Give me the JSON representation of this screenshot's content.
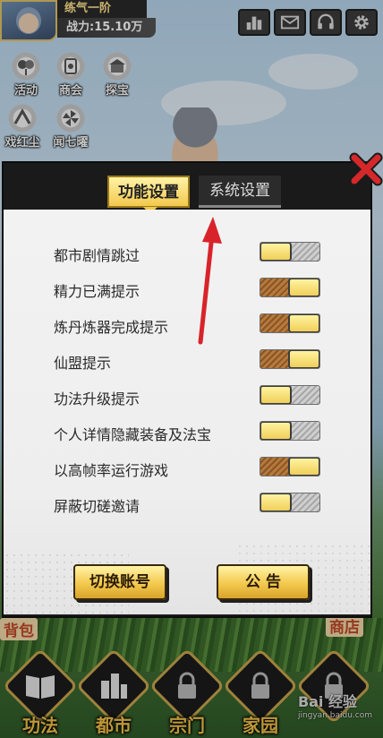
{
  "player": {
    "name": "练气一阶",
    "power": "战力:15.10万"
  },
  "top_icons": [
    "ranking-icon",
    "mail-icon",
    "headset-icon",
    "gear-icon"
  ],
  "quick_actions": [
    {
      "label": "活动",
      "icon": "activity-icon"
    },
    {
      "label": "商会",
      "icon": "shop-icon"
    },
    {
      "label": "探宝",
      "icon": "treasure-icon"
    },
    {
      "label": "戏红尘",
      "icon": "fan-icon"
    },
    {
      "label": "闻七曜",
      "icon": "pinwheel-icon"
    }
  ],
  "dialog": {
    "tabs": {
      "active": "功能设置",
      "inactive": "系统设置"
    },
    "settings": [
      {
        "label": "都市剧情跳过",
        "state": "off"
      },
      {
        "label": "精力已满提示",
        "state": "on"
      },
      {
        "label": "炼丹炼器完成提示",
        "state": "on"
      },
      {
        "label": "仙盟提示",
        "state": "on"
      },
      {
        "label": "功法升级提示",
        "state": "off"
      },
      {
        "label": "个人详情隐藏装备及法宝",
        "state": "off"
      },
      {
        "label": "以高帧率运行游戏",
        "state": "on"
      },
      {
        "label": "屏蔽切磋邀请",
        "state": "off"
      }
    ],
    "buttons": {
      "switch_account": "切换账号",
      "announcement": "公 告"
    }
  },
  "side_tags": {
    "left": "背包",
    "right": "商店"
  },
  "bottom_nav": [
    {
      "label": "功法",
      "icon": "book-icon",
      "locked": false
    },
    {
      "label": "都市",
      "icon": "city-icon",
      "locked": false
    },
    {
      "label": "宗门",
      "icon": "lock-icon",
      "locked": true
    },
    {
      "label": "家园",
      "icon": "lock-icon",
      "locked": true
    },
    {
      "label": "",
      "icon": "lock-icon",
      "locked": true
    }
  ],
  "watermark": {
    "brand": "Bai 经验",
    "url": "jingyan.baidu.com"
  },
  "colors": {
    "gold": "#f3c94d",
    "toggle_on": "#b57a3c",
    "toggle_off": "#bdbdbd",
    "close_red": "#d4282b"
  }
}
